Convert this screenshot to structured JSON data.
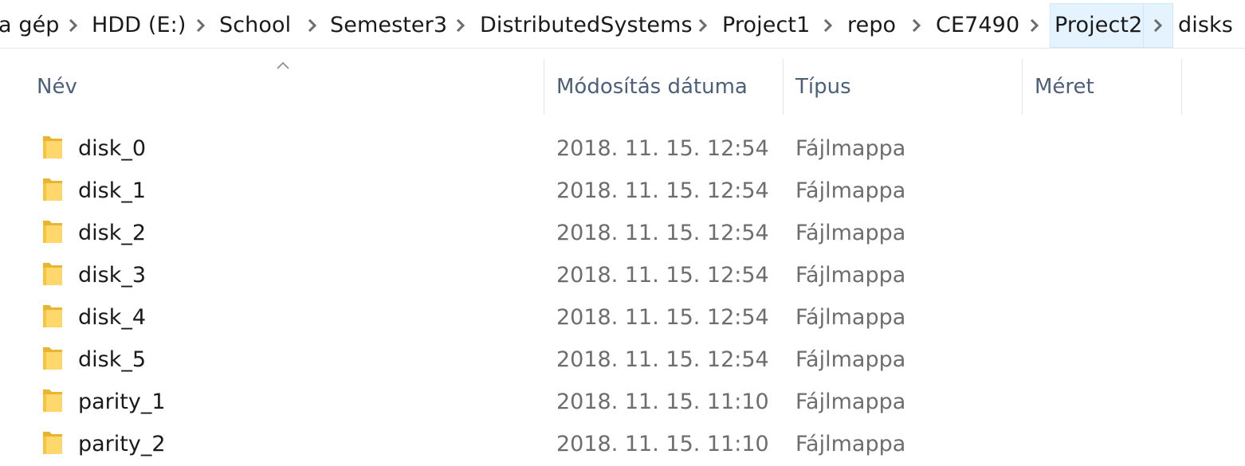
{
  "breadcrumb": {
    "items": [
      {
        "label": "a gép"
      },
      {
        "label": "HDD (E:)"
      },
      {
        "label": "School"
      },
      {
        "label": "Semester3"
      },
      {
        "label": "DistributedSystems"
      },
      {
        "label": "Project1"
      },
      {
        "label": "repo"
      },
      {
        "label": "CE7490"
      },
      {
        "label": "Project2"
      },
      {
        "label": "disks"
      }
    ],
    "selected_item": "Project2",
    "separator_icon": "chevron-right-icon"
  },
  "columns": {
    "name": "Név",
    "date": "Módosítás dátuma",
    "type": "Típus",
    "size": "Méret",
    "sorted_by": "name",
    "sort_icon": "sort-ascending-caret-icon"
  },
  "files": [
    {
      "name": "disk_0",
      "date": "2018. 11. 15. 12:54",
      "type": "Fájlmappa",
      "size": "",
      "icon": "folder-icon"
    },
    {
      "name": "disk_1",
      "date": "2018. 11. 15. 12:54",
      "type": "Fájlmappa",
      "size": "",
      "icon": "folder-icon"
    },
    {
      "name": "disk_2",
      "date": "2018. 11. 15. 12:54",
      "type": "Fájlmappa",
      "size": "",
      "icon": "folder-icon"
    },
    {
      "name": "disk_3",
      "date": "2018. 11. 15. 12:54",
      "type": "Fájlmappa",
      "size": "",
      "icon": "folder-icon"
    },
    {
      "name": "disk_4",
      "date": "2018. 11. 15. 12:54",
      "type": "Fájlmappa",
      "size": "",
      "icon": "folder-icon"
    },
    {
      "name": "disk_5",
      "date": "2018. 11. 15. 12:54",
      "type": "Fájlmappa",
      "size": "",
      "icon": "folder-icon"
    },
    {
      "name": "parity_1",
      "date": "2018. 11. 15. 11:10",
      "type": "Fájlmappa",
      "size": "",
      "icon": "folder-icon"
    },
    {
      "name": "parity_2",
      "date": "2018. 11. 15. 11:10",
      "type": "Fájlmappa",
      "size": "",
      "icon": "folder-icon"
    }
  ],
  "colors": {
    "selection_background": "#e5f3ff",
    "selection_border": "#cce8ff",
    "header_text": "#4c607a",
    "secondary_text": "#6d6d6d",
    "primary_text": "#1a1a1a",
    "folder_yellow": "#ffd76a"
  }
}
